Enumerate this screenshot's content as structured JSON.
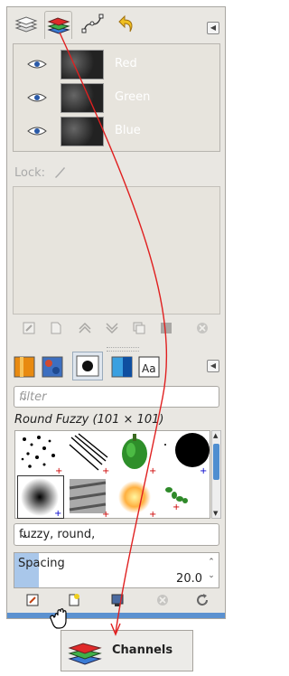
{
  "dock": {
    "tabs": [
      {
        "name": "layers-tab"
      },
      {
        "name": "channels-tab",
        "active": true
      },
      {
        "name": "paths-tab"
      },
      {
        "name": "undo-history-tab"
      }
    ]
  },
  "channels": {
    "rows": [
      {
        "label": "Red"
      },
      {
        "label": "Green"
      },
      {
        "label": "Blue"
      }
    ]
  },
  "lock": {
    "label": "Lock:"
  },
  "brushes": {
    "filter_placeholder": "filter",
    "selected_brush": "Round Fuzzy (101 × 101)",
    "tags_value": "fuzzy, round,",
    "spacing_label": "Spacing",
    "spacing_value": "20.0",
    "spacing_percent": 12
  },
  "tooltip": {
    "label": "Channels"
  },
  "colors": {
    "accent": "#5b91d0",
    "red_arrow": "#e02020"
  }
}
